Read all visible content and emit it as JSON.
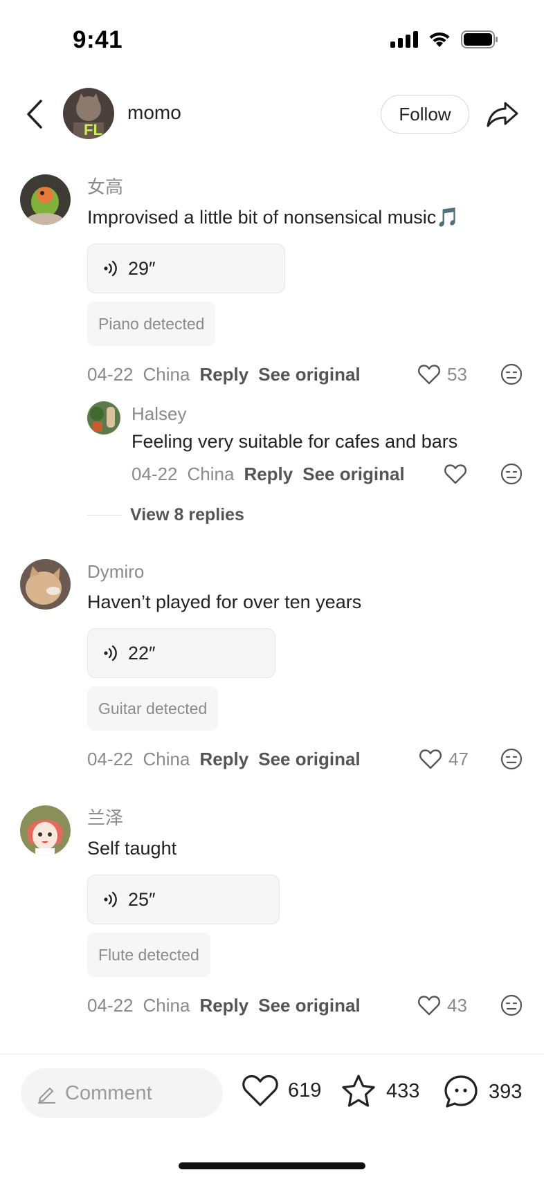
{
  "status_bar": {
    "time": "9:41"
  },
  "header": {
    "username": "momo",
    "follow_label": "Follow"
  },
  "comments": [
    {
      "name": "女高",
      "text": "Improvised a little bit of nonsensical music🎵",
      "voice_length": "29″",
      "detected": "Piano detected",
      "date": "04-22",
      "location": "China",
      "reply_label": "Reply",
      "see_original_label": "See original",
      "likes": "53",
      "sub_reply": {
        "name": "Halsey",
        "text": "Feeling very suitable for cafes and bars",
        "date": "04-22",
        "location": "China",
        "reply_label": "Reply",
        "see_original_label": "See original"
      },
      "view_replies_label": "View",
      "view_replies_count": "8",
      "view_replies_suffix": "replies"
    },
    {
      "name": "Dymiro",
      "text": "Haven’t played for over ten years",
      "voice_length": "22″",
      "detected": "Guitar detected",
      "date": "04-22",
      "location": "China",
      "reply_label": "Reply",
      "see_original_label": "See original",
      "likes": "47"
    },
    {
      "name": "兰泽",
      "text": "Self taught",
      "voice_length": "25″",
      "detected": "Flute detected",
      "date": "04-22",
      "location": "China",
      "reply_label": "Reply",
      "see_original_label": "See original",
      "likes": "43"
    }
  ],
  "bottom_bar": {
    "comment_placeholder": "Comment",
    "likes": "619",
    "favorites": "433",
    "comments": "393"
  },
  "icons": [
    "back-icon",
    "share-icon",
    "heart-icon",
    "dislike-icon",
    "voice-icon",
    "pencil-icon",
    "star-icon",
    "chat-icon",
    "signal-icon",
    "wifi-icon",
    "battery-icon"
  ],
  "colors": {
    "text_primary": "#222222",
    "text_secondary": "#8a8a8a",
    "chip_bg": "#f6f6f6"
  }
}
